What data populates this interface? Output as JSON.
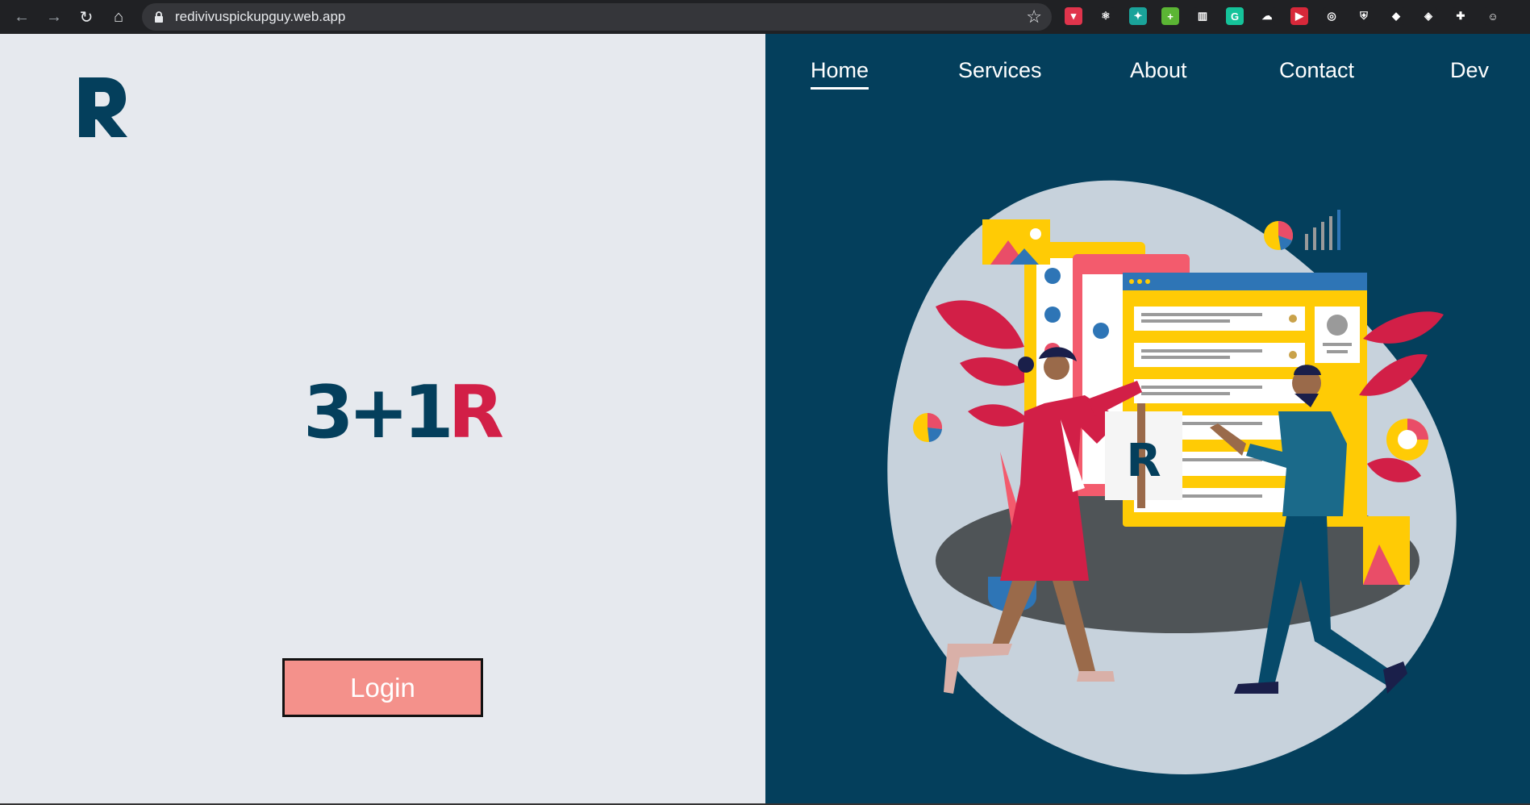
{
  "browser": {
    "url": "redivivuspickupguy.web.app",
    "nav_icons": [
      "back-icon",
      "forward-icon",
      "reload-icon",
      "home-icon"
    ],
    "extensions": [
      {
        "name": "pocket-extension-icon",
        "color": "#e0344c",
        "glyph": "▾"
      },
      {
        "name": "react-devtools-extension-icon",
        "color": "#202124",
        "glyph": "⚛"
      },
      {
        "name": "extension-teal-icon",
        "color": "#1aa39a",
        "glyph": "✦"
      },
      {
        "name": "extension-green-plus-icon",
        "color": "#5bb534",
        "glyph": "+"
      },
      {
        "name": "reader-extension-icon",
        "color": "#202124",
        "glyph": "▥"
      },
      {
        "name": "grammarly-extension-icon",
        "color": "#15c39a",
        "glyph": "G"
      },
      {
        "name": "extension-gray-icon",
        "color": "#202124",
        "glyph": "☁"
      },
      {
        "name": "extension-red-play-icon",
        "color": "#d8283a",
        "glyph": "▶"
      },
      {
        "name": "extension-glasses-icon",
        "color": "#202124",
        "glyph": "◎"
      },
      {
        "name": "extension-shield-icon",
        "color": "#202124",
        "glyph": "⛨"
      },
      {
        "name": "colorpick-extension-icon",
        "color": "#202124",
        "glyph": "◆"
      },
      {
        "name": "extension-blue-icon",
        "color": "#202124",
        "glyph": "◈"
      },
      {
        "name": "extensions-puzzle-icon",
        "color": "#202124",
        "glyph": "✚"
      },
      {
        "name": "profile-avatar-icon",
        "color": "#202124",
        "glyph": "☺"
      }
    ]
  },
  "headline": {
    "dark_part": "3+1",
    "red_part": "R"
  },
  "login": {
    "label": "Login"
  },
  "nav": {
    "items": [
      {
        "label": "Home",
        "active": true
      },
      {
        "label": "Services",
        "active": false
      },
      {
        "label": "About",
        "active": false
      },
      {
        "label": "Contact",
        "active": false
      },
      {
        "label": "Dev",
        "active": false
      }
    ]
  },
  "colors": {
    "navy": "#043f5c",
    "red": "#d21f47",
    "light_bg": "#e6e9ee",
    "login_bg": "#f4918b",
    "yellow": "#ffcb05"
  }
}
